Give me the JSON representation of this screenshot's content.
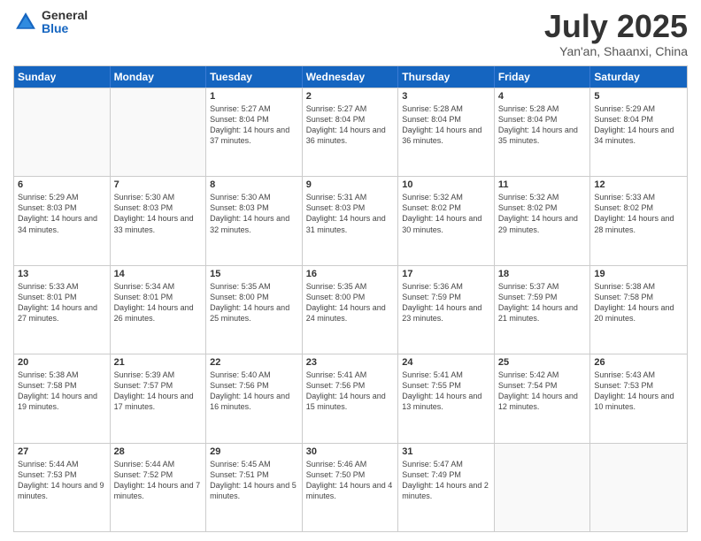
{
  "logo": {
    "general": "General",
    "blue": "Blue"
  },
  "title": "July 2025",
  "subtitle": "Yan'an, Shaanxi, China",
  "header_days": [
    "Sunday",
    "Monday",
    "Tuesday",
    "Wednesday",
    "Thursday",
    "Friday",
    "Saturday"
  ],
  "weeks": [
    [
      {
        "day": "",
        "sunrise": "",
        "sunset": "",
        "daylight": ""
      },
      {
        "day": "",
        "sunrise": "",
        "sunset": "",
        "daylight": ""
      },
      {
        "day": "1",
        "sunrise": "Sunrise: 5:27 AM",
        "sunset": "Sunset: 8:04 PM",
        "daylight": "Daylight: 14 hours and 37 minutes."
      },
      {
        "day": "2",
        "sunrise": "Sunrise: 5:27 AM",
        "sunset": "Sunset: 8:04 PM",
        "daylight": "Daylight: 14 hours and 36 minutes."
      },
      {
        "day": "3",
        "sunrise": "Sunrise: 5:28 AM",
        "sunset": "Sunset: 8:04 PM",
        "daylight": "Daylight: 14 hours and 36 minutes."
      },
      {
        "day": "4",
        "sunrise": "Sunrise: 5:28 AM",
        "sunset": "Sunset: 8:04 PM",
        "daylight": "Daylight: 14 hours and 35 minutes."
      },
      {
        "day": "5",
        "sunrise": "Sunrise: 5:29 AM",
        "sunset": "Sunset: 8:04 PM",
        "daylight": "Daylight: 14 hours and 34 minutes."
      }
    ],
    [
      {
        "day": "6",
        "sunrise": "Sunrise: 5:29 AM",
        "sunset": "Sunset: 8:03 PM",
        "daylight": "Daylight: 14 hours and 34 minutes."
      },
      {
        "day": "7",
        "sunrise": "Sunrise: 5:30 AM",
        "sunset": "Sunset: 8:03 PM",
        "daylight": "Daylight: 14 hours and 33 minutes."
      },
      {
        "day": "8",
        "sunrise": "Sunrise: 5:30 AM",
        "sunset": "Sunset: 8:03 PM",
        "daylight": "Daylight: 14 hours and 32 minutes."
      },
      {
        "day": "9",
        "sunrise": "Sunrise: 5:31 AM",
        "sunset": "Sunset: 8:03 PM",
        "daylight": "Daylight: 14 hours and 31 minutes."
      },
      {
        "day": "10",
        "sunrise": "Sunrise: 5:32 AM",
        "sunset": "Sunset: 8:02 PM",
        "daylight": "Daylight: 14 hours and 30 minutes."
      },
      {
        "day": "11",
        "sunrise": "Sunrise: 5:32 AM",
        "sunset": "Sunset: 8:02 PM",
        "daylight": "Daylight: 14 hours and 29 minutes."
      },
      {
        "day": "12",
        "sunrise": "Sunrise: 5:33 AM",
        "sunset": "Sunset: 8:02 PM",
        "daylight": "Daylight: 14 hours and 28 minutes."
      }
    ],
    [
      {
        "day": "13",
        "sunrise": "Sunrise: 5:33 AM",
        "sunset": "Sunset: 8:01 PM",
        "daylight": "Daylight: 14 hours and 27 minutes."
      },
      {
        "day": "14",
        "sunrise": "Sunrise: 5:34 AM",
        "sunset": "Sunset: 8:01 PM",
        "daylight": "Daylight: 14 hours and 26 minutes."
      },
      {
        "day": "15",
        "sunrise": "Sunrise: 5:35 AM",
        "sunset": "Sunset: 8:00 PM",
        "daylight": "Daylight: 14 hours and 25 minutes."
      },
      {
        "day": "16",
        "sunrise": "Sunrise: 5:35 AM",
        "sunset": "Sunset: 8:00 PM",
        "daylight": "Daylight: 14 hours and 24 minutes."
      },
      {
        "day": "17",
        "sunrise": "Sunrise: 5:36 AM",
        "sunset": "Sunset: 7:59 PM",
        "daylight": "Daylight: 14 hours and 23 minutes."
      },
      {
        "day": "18",
        "sunrise": "Sunrise: 5:37 AM",
        "sunset": "Sunset: 7:59 PM",
        "daylight": "Daylight: 14 hours and 21 minutes."
      },
      {
        "day": "19",
        "sunrise": "Sunrise: 5:38 AM",
        "sunset": "Sunset: 7:58 PM",
        "daylight": "Daylight: 14 hours and 20 minutes."
      }
    ],
    [
      {
        "day": "20",
        "sunrise": "Sunrise: 5:38 AM",
        "sunset": "Sunset: 7:58 PM",
        "daylight": "Daylight: 14 hours and 19 minutes."
      },
      {
        "day": "21",
        "sunrise": "Sunrise: 5:39 AM",
        "sunset": "Sunset: 7:57 PM",
        "daylight": "Daylight: 14 hours and 17 minutes."
      },
      {
        "day": "22",
        "sunrise": "Sunrise: 5:40 AM",
        "sunset": "Sunset: 7:56 PM",
        "daylight": "Daylight: 14 hours and 16 minutes."
      },
      {
        "day": "23",
        "sunrise": "Sunrise: 5:41 AM",
        "sunset": "Sunset: 7:56 PM",
        "daylight": "Daylight: 14 hours and 15 minutes."
      },
      {
        "day": "24",
        "sunrise": "Sunrise: 5:41 AM",
        "sunset": "Sunset: 7:55 PM",
        "daylight": "Daylight: 14 hours and 13 minutes."
      },
      {
        "day": "25",
        "sunrise": "Sunrise: 5:42 AM",
        "sunset": "Sunset: 7:54 PM",
        "daylight": "Daylight: 14 hours and 12 minutes."
      },
      {
        "day": "26",
        "sunrise": "Sunrise: 5:43 AM",
        "sunset": "Sunset: 7:53 PM",
        "daylight": "Daylight: 14 hours and 10 minutes."
      }
    ],
    [
      {
        "day": "27",
        "sunrise": "Sunrise: 5:44 AM",
        "sunset": "Sunset: 7:53 PM",
        "daylight": "Daylight: 14 hours and 9 minutes."
      },
      {
        "day": "28",
        "sunrise": "Sunrise: 5:44 AM",
        "sunset": "Sunset: 7:52 PM",
        "daylight": "Daylight: 14 hours and 7 minutes."
      },
      {
        "day": "29",
        "sunrise": "Sunrise: 5:45 AM",
        "sunset": "Sunset: 7:51 PM",
        "daylight": "Daylight: 14 hours and 5 minutes."
      },
      {
        "day": "30",
        "sunrise": "Sunrise: 5:46 AM",
        "sunset": "Sunset: 7:50 PM",
        "daylight": "Daylight: 14 hours and 4 minutes."
      },
      {
        "day": "31",
        "sunrise": "Sunrise: 5:47 AM",
        "sunset": "Sunset: 7:49 PM",
        "daylight": "Daylight: 14 hours and 2 minutes."
      },
      {
        "day": "",
        "sunrise": "",
        "sunset": "",
        "daylight": ""
      },
      {
        "day": "",
        "sunrise": "",
        "sunset": "",
        "daylight": ""
      }
    ]
  ]
}
